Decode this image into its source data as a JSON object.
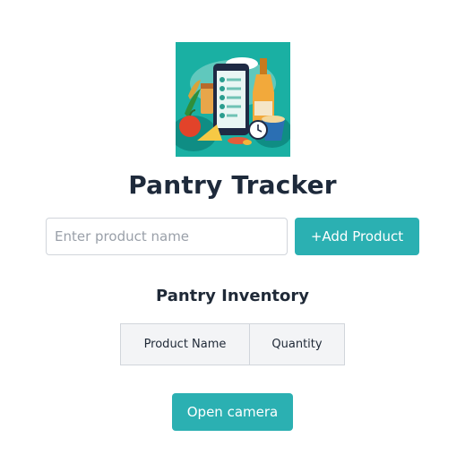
{
  "app": {
    "title": "Pantry Tracker"
  },
  "form": {
    "placeholder": "Enter product name",
    "value": "",
    "add_label": "+Add Product"
  },
  "inventory": {
    "title": "Pantry Inventory",
    "columns": [
      "Product Name",
      "Quantity"
    ],
    "rows": []
  },
  "camera": {
    "label": "Open camera"
  },
  "colors": {
    "accent": "#2bb0b2",
    "title_text": "#1e2a3b",
    "logo_background": "#1ab0a3"
  },
  "icons": {
    "logo": "pantry-app-illustration"
  }
}
